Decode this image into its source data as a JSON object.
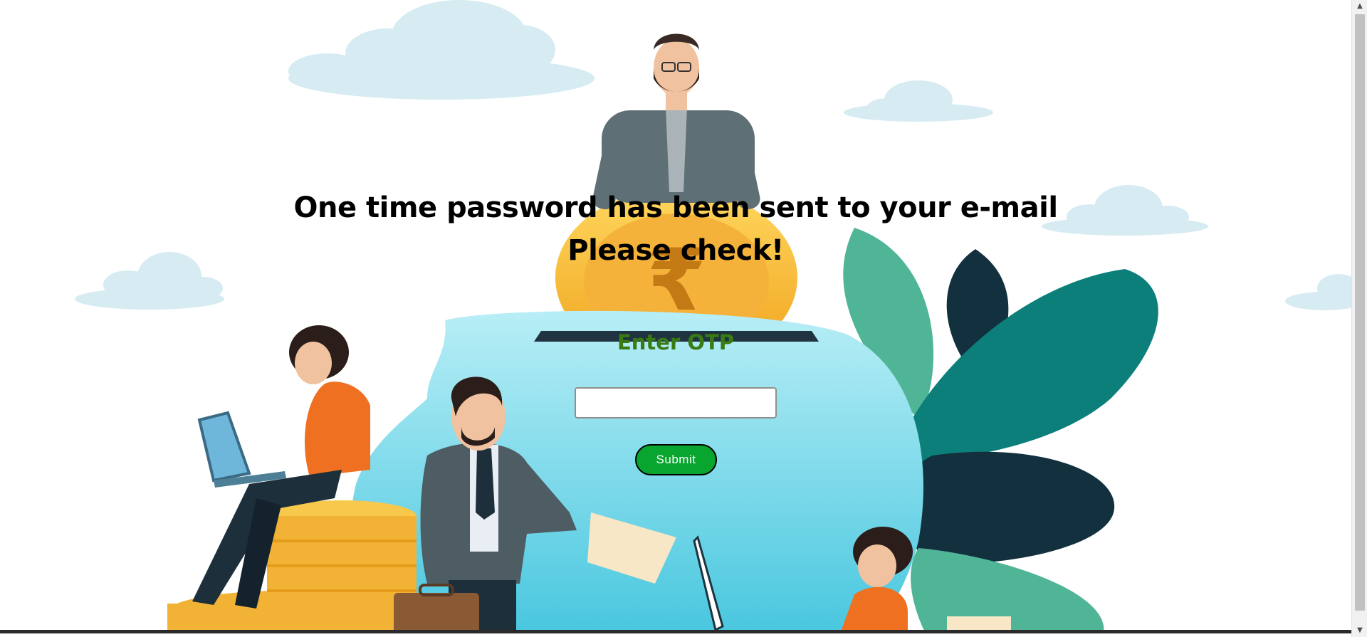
{
  "header": {
    "line1": "One time password has been sent to your e-mail",
    "line2": "Please check!"
  },
  "form": {
    "label": "Enter OTP",
    "otp_value": "",
    "submit_label": "Submit"
  },
  "illustration": {
    "currency_symbol": "₹"
  },
  "colors": {
    "heading": "#000000",
    "label": "#3a7a12",
    "submit_background": "#08a52f",
    "submit_text": "#ffffff",
    "piggy_bank": "#7fd9ea",
    "coin": "#f5b83a",
    "leaves": "#0c7f7a",
    "clouds": "#d6ecf2"
  },
  "icons": {
    "scroll_up": "triangle-up-icon",
    "scroll_down": "triangle-down-icon"
  }
}
